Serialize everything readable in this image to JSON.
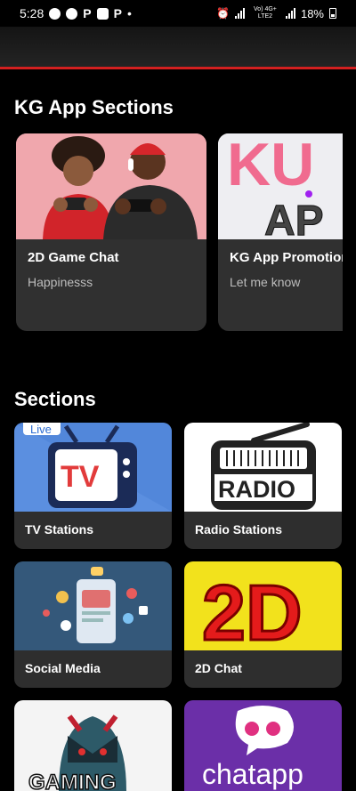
{
  "status": {
    "time": "5:28",
    "dot": "•",
    "p1": "P",
    "p2": "P",
    "net": "Vo) 4G+ LTE2",
    "battery": "18%"
  },
  "sections_heading": "KG App Sections",
  "featured": [
    {
      "title": "2D Game Chat",
      "subtitle": "Happinesss",
      "image": "people-gaming-photo"
    },
    {
      "title": "KG App Promotion",
      "subtitle": "Let me know",
      "image": "kg-app-logo"
    }
  ],
  "grid_heading": "Sections",
  "grid": [
    {
      "label": "TV Stations",
      "image": "tv-live-icon",
      "badge": "Live",
      "tv_text": "TV"
    },
    {
      "label": "Radio Stations",
      "image": "radio-icon",
      "radio_text": "RADIO"
    },
    {
      "label": "Social Media",
      "image": "social-media-illustration"
    },
    {
      "label": "2D Chat",
      "image": "2d-logo",
      "logo_text": "2D"
    },
    {
      "label": "",
      "image": "gaming-mascot",
      "logo_text": "GAMING"
    },
    {
      "label": "",
      "image": "chatapp-logo",
      "logo_text": "chatapp"
    }
  ],
  "promo_logo_text": "KU AP",
  "colors": {
    "accent_red": "#d32020",
    "card_bg": "#2e2e2e",
    "bg": "#000000"
  }
}
